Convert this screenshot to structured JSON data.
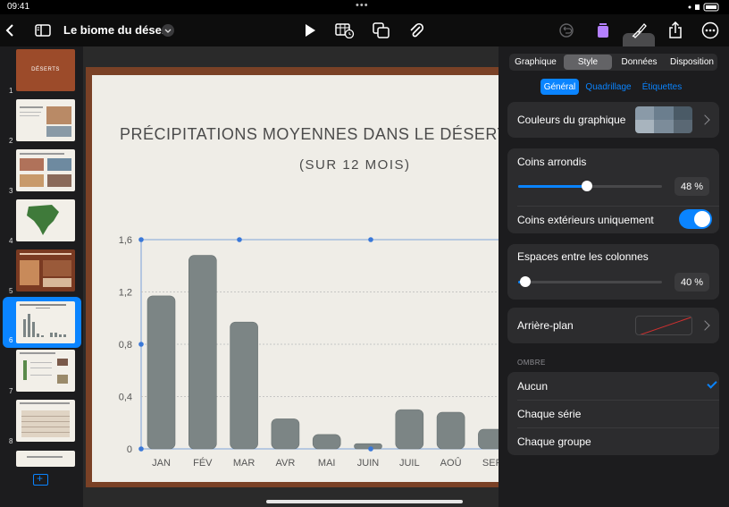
{
  "status_bar": {
    "time": "09:41",
    "dots": "•••"
  },
  "toolbar": {
    "document_title": "Le biome du désert",
    "icons": [
      "back-icon",
      "sidebar-icon",
      "title-chevron-icon",
      "play-icon",
      "table-insert-icon",
      "shapes-icon",
      "attachment-icon",
      "undo-icon",
      "jar-icon",
      "format-brush-icon",
      "share-icon",
      "more-icon"
    ]
  },
  "slides": {
    "numbers": [
      "1",
      "2",
      "3",
      "4",
      "5",
      "6",
      "7",
      "8"
    ],
    "selected": "6",
    "slide1_title": "DÉSERTS"
  },
  "slide": {
    "title": "PRÉCIPITATIONS MOYENNES DANS LE DÉSERT",
    "subtitle": "(SUR 12 MOIS)"
  },
  "chart_data": {
    "type": "bar",
    "title": "PRÉCIPITATIONS MOYENNES DANS LE DÉSERT",
    "subtitle": "(SUR 12 MOIS)",
    "categories": [
      "JAN",
      "FÉV",
      "MAR",
      "AVR",
      "MAI",
      "JUIN",
      "JUIL",
      "AOÛ",
      "SEP"
    ],
    "values": [
      1.17,
      1.48,
      0.97,
      0.23,
      0.11,
      0.04,
      0.3,
      0.28,
      0.15
    ],
    "yticks": [
      "0",
      "0,4",
      "0,8",
      "1,2",
      "1,6"
    ],
    "ylim": [
      0,
      1.6
    ],
    "grid": true,
    "bar_color": "#7c8585"
  },
  "panel": {
    "tabs": [
      "Graphique",
      "Style",
      "Données",
      "Disposition"
    ],
    "active_tab": "Style",
    "subtabs": [
      "Général",
      "Quadrillage",
      "Étiquettes"
    ],
    "active_subtab": "Général",
    "chart_colors_label": "Couleurs du graphique",
    "rounded_corners_label": "Coins arrondis",
    "rounded_corners_value": "48 %",
    "rounded_corners_level": 0.48,
    "outer_corners_label": "Coins extérieurs uniquement",
    "outer_corners_on": true,
    "column_gap_label": "Espaces entre les colonnes",
    "column_gap_value": "40 %",
    "column_gap_level": 0.05,
    "background_label": "Arrière-plan",
    "shadow_header": "OMBRE",
    "shadow_options": [
      "Aucun",
      "Chaque série",
      "Chaque groupe"
    ],
    "shadow_selected": "Aucun",
    "accent_color": "#0a84ff"
  }
}
